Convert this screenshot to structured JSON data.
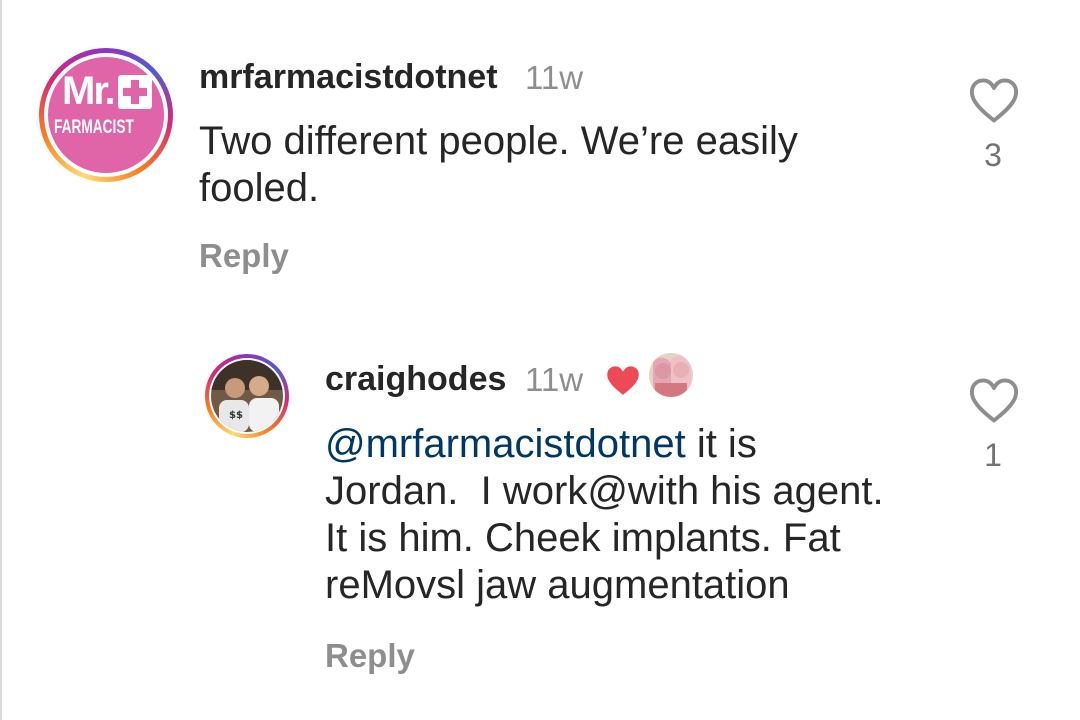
{
  "comments": [
    {
      "username": "mrfarmacistdotnet",
      "time": "11w",
      "text_lines": [
        "Two different people. We’re easily",
        "fooled."
      ],
      "reply_label": "Reply",
      "like_count": "3",
      "avatar": {
        "logo_top": "Mr.",
        "logo_bottom": "FARMACIST",
        "bg_color": "#e064a8"
      }
    },
    {
      "username": "craighodes",
      "time": "11w",
      "mention": "@mrfarmacistdotnet",
      "text_first_rest": " it is",
      "text_lines": [
        "Jordan.  I work@with his agent.",
        "It is him. Cheek implants. Fat",
        "reMovsl jaw augmentation"
      ],
      "reply_label": "Reply",
      "like_count": "1",
      "creator_liked_icon": "red-heart-icon",
      "creator_avatar_icon": "small-avatar"
    }
  ],
  "colors": {
    "text": "#262626",
    "muted": "#8e8e8e",
    "mention": "#00376b",
    "heart_red": "#ed4956"
  }
}
